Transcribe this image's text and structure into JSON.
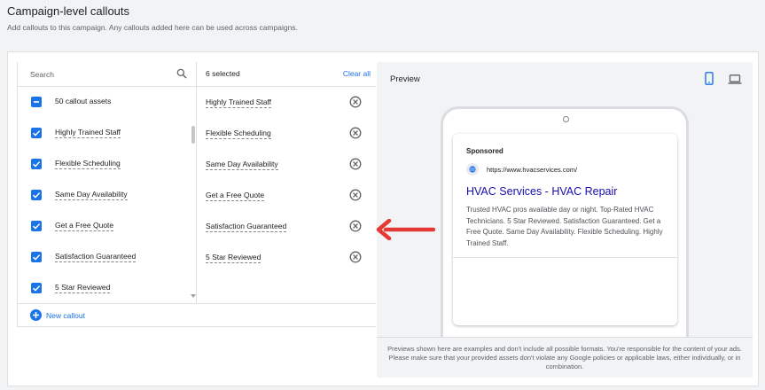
{
  "header": {
    "title": "Campaign-level callouts",
    "subtitle": "Add callouts to this campaign. Any callouts added here can be used across campaigns."
  },
  "search": {
    "placeholder": "Search"
  },
  "assets": {
    "header_label": "50 callout assets",
    "items": [
      {
        "label": "Highly Trained Staff",
        "checked": true
      },
      {
        "label": "Flexible Scheduling",
        "checked": true
      },
      {
        "label": "Same Day Availability",
        "checked": true
      },
      {
        "label": "Get a Free Quote",
        "checked": true
      },
      {
        "label": "Satisfaction Guaranteed",
        "checked": true
      },
      {
        "label": "5 Star Reviewed",
        "checked": true
      }
    ]
  },
  "selected": {
    "count_label": "6 selected",
    "clear_label": "Clear all",
    "items": [
      {
        "label": "Highly Trained Staff"
      },
      {
        "label": "Flexible Scheduling"
      },
      {
        "label": "Same Day Availability"
      },
      {
        "label": "Get a Free Quote"
      },
      {
        "label": "Satisfaction Guaranteed"
      },
      {
        "label": "5 Star Reviewed"
      }
    ]
  },
  "new_callout": {
    "label": "New callout"
  },
  "preview": {
    "title": "Preview",
    "sponsored": "Sponsored",
    "url": "https://www.hvacservices.com/",
    "headline": "HVAC Services - HVAC Repair",
    "description": "Trusted HVAC pros available day or night. Top-Rated HVAC Technicians. 5 Star Reviewed. Satisfaction Guaranteed. Get a Free Quote. Same Day Availability. Flexible Scheduling. Highly Trained Staff.",
    "footer": "Previews shown here are examples and don't include all possible formats. You're responsible for the content of your ads. Please make sure that your provided assets don't violate any Google policies or applicable laws, either individually, or in combination."
  },
  "colors": {
    "accent": "#1a73e8",
    "arrow": "#e53935",
    "headline": "#1a0dab"
  }
}
